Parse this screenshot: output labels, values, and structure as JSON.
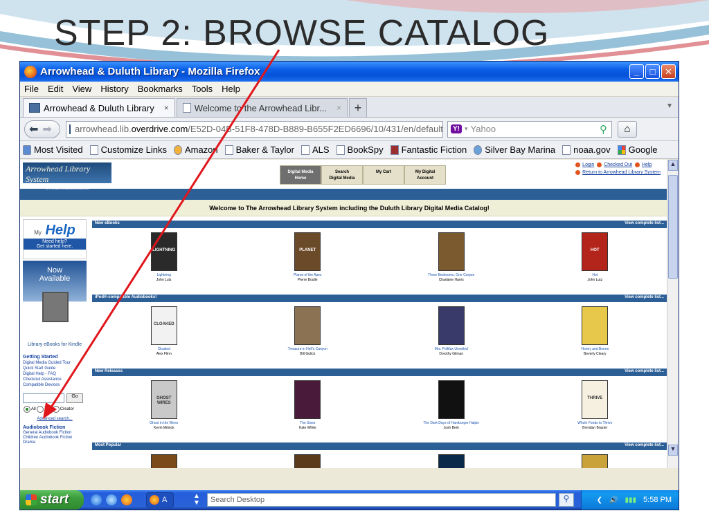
{
  "slide": {
    "title": "STEP 2:  BROWSE CATALOG"
  },
  "window": {
    "title": "Arrowhead & Duluth Library - Mozilla Firefox",
    "min": "_",
    "max": "□",
    "close": "✕"
  },
  "menu": [
    "File",
    "Edit",
    "View",
    "History",
    "Bookmarks",
    "Tools",
    "Help"
  ],
  "tabs": [
    {
      "label": "Arrowhead & Duluth Library",
      "close": "×"
    },
    {
      "label": "Welcome to the Arrowhead Libr...",
      "close": "×"
    }
  ],
  "newtab": "+",
  "nav": {
    "url_prefix": "arrowhead.lib.",
    "url_domain": "overdrive.com",
    "url_rest": "/E52D-04B-51F8-478D-B889-B655F2ED6696/10/431/en/default.h",
    "search_brand": "Y!",
    "search_placeholder": "Yahoo"
  },
  "bookmarks": [
    "Most Visited",
    "Customize Links",
    "Amazon",
    "Baker & Taylor",
    "ALS",
    "BookSpy",
    "Fantastic Fiction",
    "Silver Bay Marina",
    "noaa.gov",
    "Google"
  ],
  "site": {
    "logo": "Arrowhead Library System",
    "logo_sub": "www.arrowhead.lib.mn.us",
    "tabs": [
      {
        "l1": "Digital Media",
        "l2": "Home"
      },
      {
        "l1": "Search",
        "l2": "Digital Media"
      },
      {
        "l1": "My Cart",
        "l2": ""
      },
      {
        "l1": "My Digital",
        "l2": "Account"
      }
    ],
    "links": [
      "Login",
      "Checked Out",
      "Help",
      "Return to Arrowhead Library System"
    ],
    "welcome": "Welcome to The Arrowhead Library System including the Duluth Library Digital Media Catalog!"
  },
  "left": {
    "myhelp": "Help",
    "myhelp_my": "My",
    "myhelp_sub": "Need help?",
    "myhelp_sub2": "Get started here.",
    "now": "Now",
    "available": "Available",
    "kindle_cap": "Library eBooks for Kindle",
    "getting_started": "Getting Started",
    "gs_links": [
      "Digital Media Guided Tour",
      "Quick Start Guide",
      "Digital Help - FAQ",
      "Checkout Assistance",
      "Compatible Devices"
    ],
    "go": "Go",
    "r_all": "All",
    "r_title": "Title",
    "r_creator": "Creator",
    "advanced": "Advanced search...",
    "cat_head": "Audiobook Fiction",
    "cat_links": [
      "General Audiobook Fiction",
      "Children Audiobook Fiction",
      "Drama"
    ]
  },
  "sections": [
    {
      "head": "New eBooks",
      "more": "View complete list...",
      "books": [
        {
          "title": "Lightning",
          "author": "John Lutz",
          "color": "#2a2a2a",
          "ct": "LIGHTNING"
        },
        {
          "title": "Planet of the Apes",
          "author": "Pierre Boulle",
          "color": "#6b4a2a",
          "ct": "PLANET"
        },
        {
          "title": "Three Bedrooms, One Corpse",
          "author": "Charlaine Harris",
          "color": "#7a5a2e",
          "ct": ""
        },
        {
          "title": "Hot",
          "author": "John Lutz",
          "color": "#b3241a",
          "ct": "HOT"
        }
      ]
    },
    {
      "head": "iPod®-compatible Audiobooks!",
      "more": "View complete list...",
      "books": [
        {
          "title": "Cloaked",
          "author": "Alex Flinn",
          "color": "#f2f2f2",
          "ct": "CLOAKED"
        },
        {
          "title": "Treasure in Hell's Canyon",
          "author": "Bill Gulick",
          "color": "#8a7252",
          "ct": ""
        },
        {
          "title": "Mrs. Pollifax Unveiled",
          "author": "Dorothy Gilman",
          "color": "#3a3a6a",
          "ct": ""
        },
        {
          "title": "Honey and Bones",
          "author": "Beverly Cleary",
          "color": "#e8c84a",
          "ct": ""
        }
      ]
    },
    {
      "head": "New Releases",
      "more": "View complete list...",
      "books": [
        {
          "title": "Ghost in the Wires",
          "author": "Kevin Mitnick",
          "color": "#c9c9c9",
          "ct": "GHOST WIRES"
        },
        {
          "title": "The Sixes",
          "author": "Kate White",
          "color": "#4a1a3a",
          "ct": ""
        },
        {
          "title": "The Dark Days of Hamburger Halpin",
          "author": "Josh Berk",
          "color": "#111111",
          "ct": ""
        },
        {
          "title": "Whole Foods to Thrive",
          "author": "Brendan Brazier",
          "color": "#f5f0e0",
          "ct": "THRIVE"
        }
      ]
    },
    {
      "head": "Most Popular",
      "more": "View complete list...",
      "books": [
        {
          "title": "",
          "author": "",
          "color": "#7a4a1a",
          "ct": "EVANOVICH"
        },
        {
          "title": "",
          "author": "",
          "color": "#5a3a1a",
          "ct": ""
        },
        {
          "title": "",
          "author": "",
          "color": "#0a2a4a",
          "ct": ""
        },
        {
          "title": "",
          "author": "",
          "color": "#caa23a",
          "ct": "PLUM"
        }
      ]
    }
  ],
  "taskbar": {
    "start": "start",
    "app": "A",
    "desk_search": "Search Desktop",
    "clock": "5:58 PM"
  }
}
